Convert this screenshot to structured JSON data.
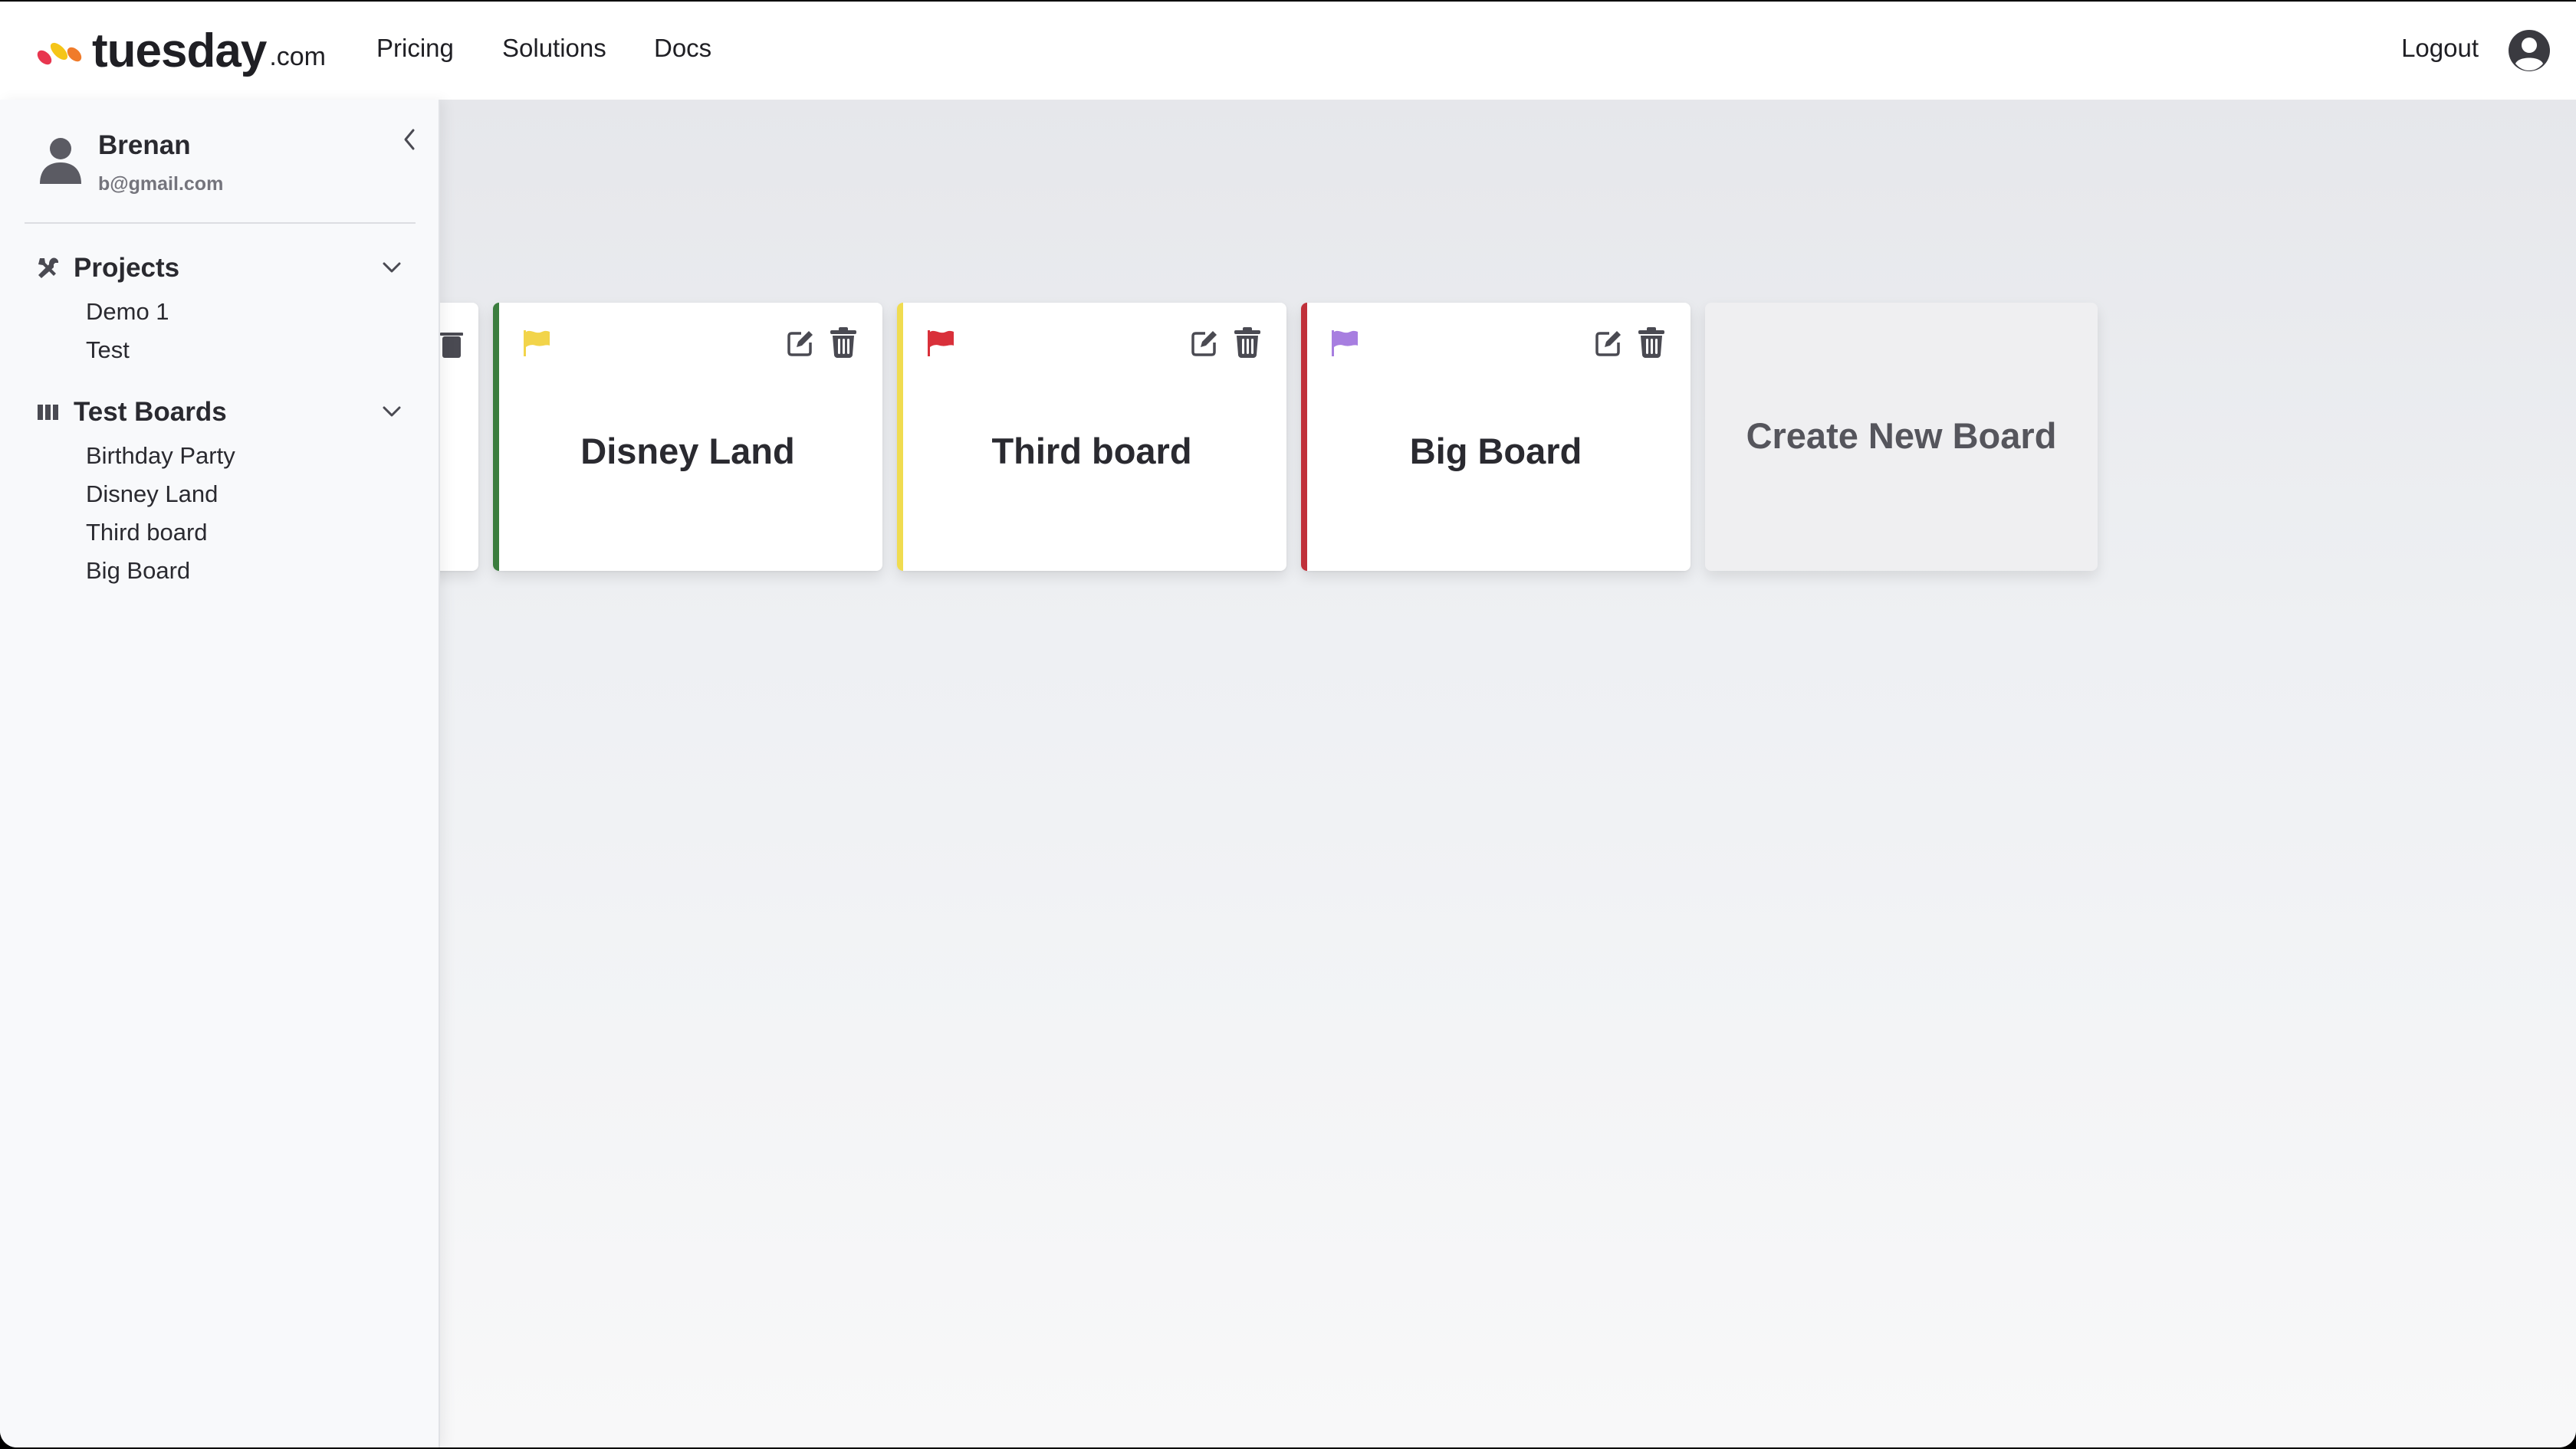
{
  "header": {
    "logo_text": "tuesday",
    "logo_tld": ".com",
    "nav": [
      "Pricing",
      "Solutions",
      "Docs"
    ],
    "logout_label": "Logout"
  },
  "sidebar": {
    "user": {
      "name": "Brenan",
      "email": "b@gmail.com"
    },
    "projects": {
      "title": "Projects",
      "items": [
        "Demo 1",
        "Test"
      ]
    },
    "boards": {
      "title": "Test Boards",
      "items": [
        "Birthday Party",
        "Disney Land",
        "Third board",
        "Big Board"
      ]
    }
  },
  "boards": [
    {
      "title": "Disney Land",
      "accent": "#3b7d3e",
      "flag": "#f2d44a"
    },
    {
      "title": "Third board",
      "accent": "#f0dc50",
      "flag": "#d9303a"
    },
    {
      "title": "Big Board",
      "accent": "#c0303a",
      "flag": "#a77ee0"
    }
  ],
  "create_board_label": "Create New Board"
}
